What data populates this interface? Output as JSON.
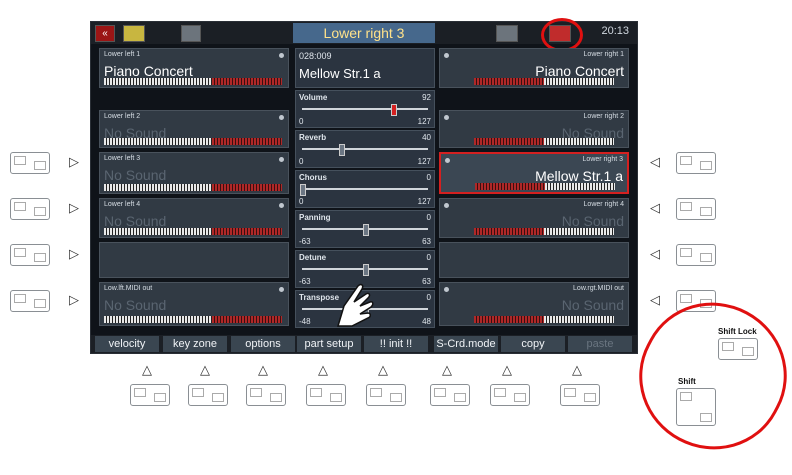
{
  "topbar": {
    "title": "Lower right 3",
    "clock": "20:13"
  },
  "left_parts": [
    {
      "small": "Lower left 1",
      "big": "Piano Concert",
      "state": "sound"
    },
    {
      "small": "Lower left 2",
      "big": "No Sound",
      "state": "nosound"
    },
    {
      "small": "Lower left 3",
      "big": "No Sound",
      "state": "nosound"
    },
    {
      "small": "Lower left 4",
      "big": "No Sound",
      "state": "nosound"
    },
    {
      "small": "",
      "big": "",
      "state": "empty"
    },
    {
      "small": "Low.lft.MIDI out",
      "big": "No Sound",
      "state": "nosound"
    }
  ],
  "right_parts": [
    {
      "small": "Lower right 1",
      "big": "Piano Concert",
      "state": "sound"
    },
    {
      "small": "Lower right 2",
      "big": "No Sound",
      "state": "nosound"
    },
    {
      "small": "Lower right 3",
      "big": "Mellow Str.1 a",
      "state": "selected"
    },
    {
      "small": "Lower right 4",
      "big": "No Sound",
      "state": "nosound"
    },
    {
      "small": "",
      "big": "",
      "state": "empty"
    },
    {
      "small": "Low.rgt.MIDI out",
      "big": "No Sound",
      "state": "nosound"
    }
  ],
  "sound_header": {
    "code": "028:009",
    "name": "Mellow Str.1 a"
  },
  "sliders": [
    {
      "name": "Volume",
      "value": "92",
      "min": "0",
      "max": "127",
      "level": 0.72
    },
    {
      "name": "Reverb",
      "value": "40",
      "min": "0",
      "max": "127",
      "level": 0.31
    },
    {
      "name": "Chorus",
      "value": "0",
      "min": "0",
      "max": "127",
      "level": 0.0
    },
    {
      "name": "Panning",
      "value": "0",
      "min": "-63",
      "max": "63",
      "level": 0.5
    },
    {
      "name": "Detune",
      "value": "0",
      "min": "-63",
      "max": "63",
      "level": 0.5
    },
    {
      "name": "Transpose",
      "value": "0",
      "min": "-48",
      "max": "48",
      "level": 0.5
    }
  ],
  "softkeys": [
    "velocity",
    "key zone",
    "options",
    "part setup",
    "!! init !!",
    "S-Crd.mode",
    "copy",
    "paste"
  ],
  "side_labels": {
    "shift_lock": "Shift Lock",
    "shift": "Shift"
  },
  "colors": {
    "accent": "#d42020",
    "title_bg": "#46688c",
    "title_text": "#ffe28a"
  }
}
